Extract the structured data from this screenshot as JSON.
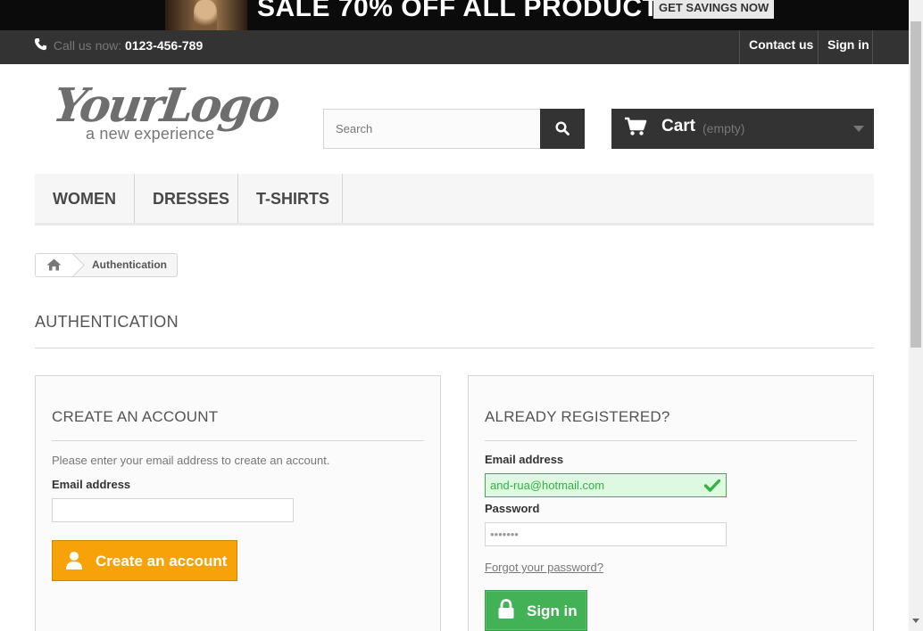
{
  "banner": {
    "text": "SALE 70% OFF ALL PRODUCTS",
    "button": "GET SAVINGS NOW"
  },
  "header": {
    "call_label": "Call us now:",
    "phone": "0123-456-789",
    "contact_link": "Contact us",
    "signin_link": "Sign in"
  },
  "logo": {
    "main": "YourLogo",
    "tagline": "a new experience"
  },
  "search": {
    "placeholder": "Search",
    "value": ""
  },
  "cart": {
    "label": "Cart",
    "status": "(empty)"
  },
  "menu": {
    "items": [
      "Women",
      "Dresses",
      "T-shirts"
    ]
  },
  "breadcrumb": {
    "current": "Authentication"
  },
  "page": {
    "heading": "AUTHENTICATION"
  },
  "create_account": {
    "title": "CREATE AN ACCOUNT",
    "hint": "Please enter your email address to create an account.",
    "email_label": "Email address",
    "email_value": "",
    "button": "Create an account"
  },
  "login": {
    "title": "ALREADY REGISTERED?",
    "email_label": "Email address",
    "email_value": "and-rua@hotmail.com",
    "password_label": "Password",
    "password_value": "•••••••",
    "forgot": "Forgot your password?",
    "button": "Sign in"
  },
  "colors": {
    "dark": "#333333",
    "orange": "#f7a209",
    "green": "#43b155",
    "valid_bg": "#ddf9e1"
  },
  "icons": [
    "phone-icon",
    "search-icon",
    "cart-icon",
    "home-icon",
    "user-icon",
    "lock-icon",
    "check-icon"
  ]
}
